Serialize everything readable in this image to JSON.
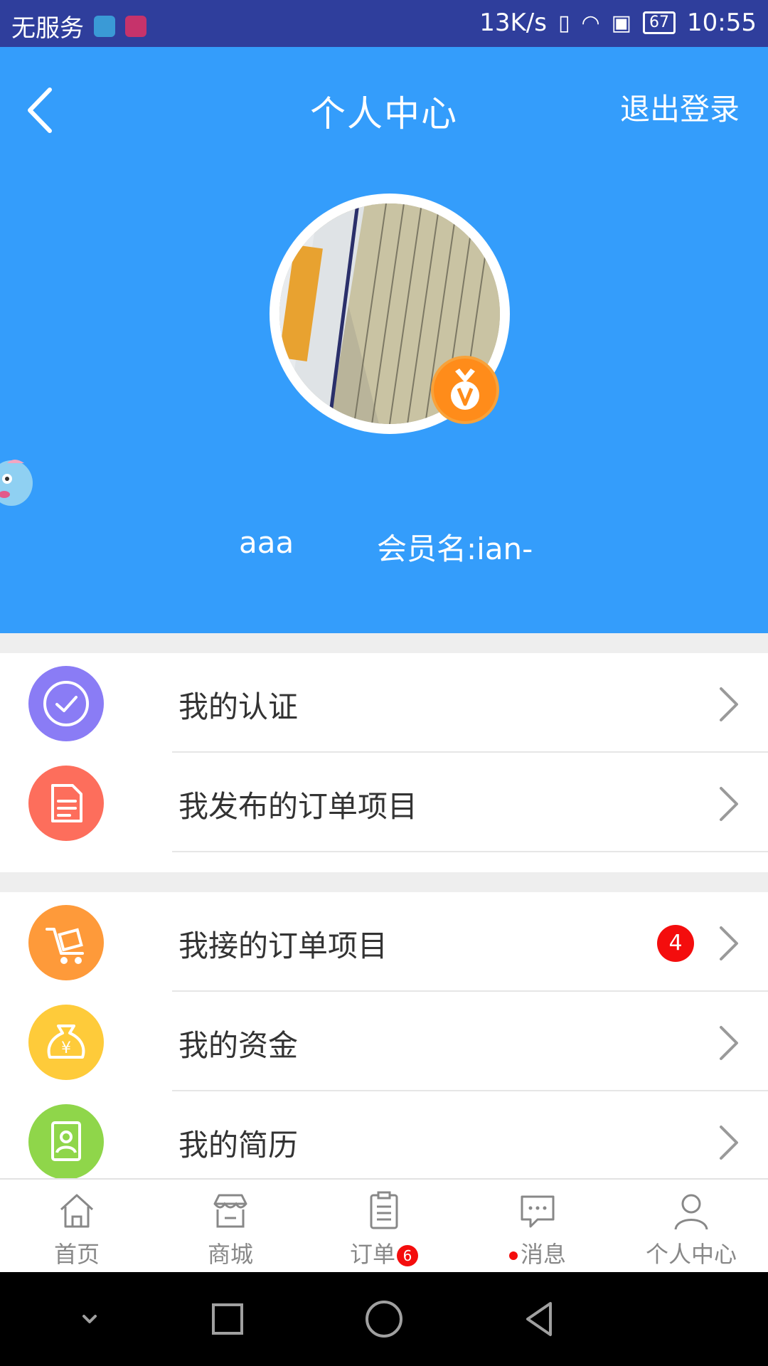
{
  "status_bar": {
    "carrier": "无服务",
    "speed": "13K/s",
    "battery": "67",
    "time": "10:55"
  },
  "header": {
    "title": "个人中心",
    "logout_label": "退出登录"
  },
  "profile": {
    "nickname": "aaa",
    "member_name": "会员名:ian-"
  },
  "menu": {
    "group1": [
      {
        "label": "我的认证",
        "icon": "check-circle-icon",
        "color": "#8a7cf5"
      },
      {
        "label": "我发布的订单项目",
        "icon": "document-icon",
        "color": "#fd6e5c"
      }
    ],
    "group2": [
      {
        "label": "我接的订单项目",
        "icon": "cart-icon",
        "color": "#fe9a3a",
        "badge": "4"
      },
      {
        "label": "我的资金",
        "icon": "money-bag-icon",
        "color": "#fecb3a"
      },
      {
        "label": "我的简历",
        "icon": "resume-icon",
        "color": "#8fd64a"
      }
    ]
  },
  "tabs": [
    {
      "label": "首页",
      "icon": "home-icon"
    },
    {
      "label": "商城",
      "icon": "store-icon"
    },
    {
      "label": "订单",
      "icon": "order-icon",
      "badge": "6"
    },
    {
      "label": "消息",
      "icon": "message-icon",
      "dot": true
    },
    {
      "label": "个人中心",
      "icon": "person-icon",
      "active": true
    }
  ],
  "colors": {
    "status_bar": "#2f3e9c",
    "header": "#349dfb",
    "badge_red": "#f40d0d",
    "vip_orange": "#ff8c1a"
  }
}
